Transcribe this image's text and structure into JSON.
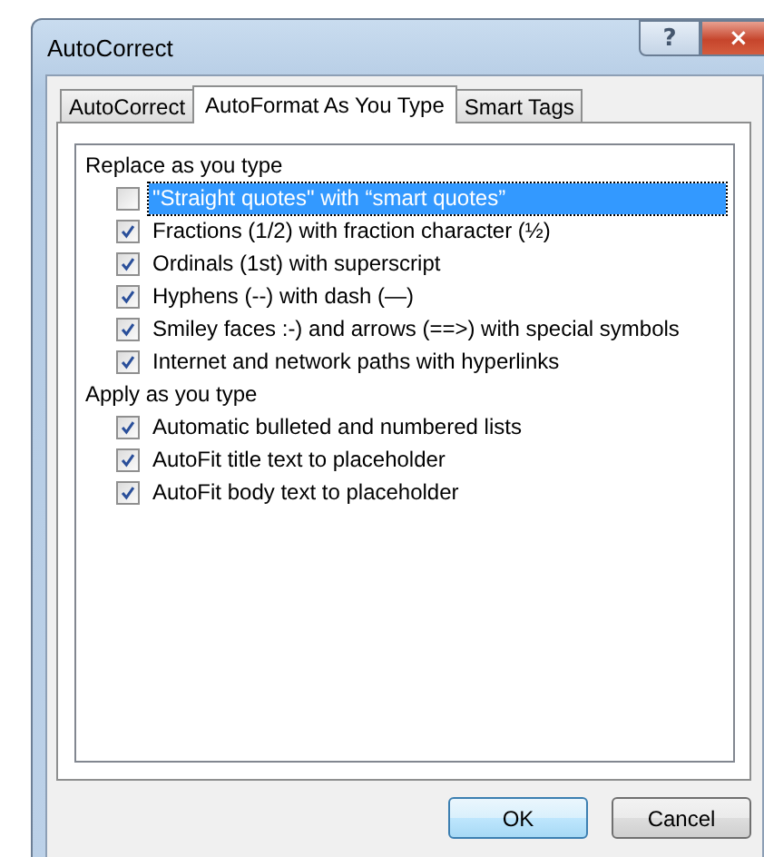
{
  "window": {
    "title": "AutoCorrect",
    "help_button": "?",
    "close_button": "×"
  },
  "tabs": [
    {
      "label": "AutoCorrect",
      "selected": false
    },
    {
      "label": "AutoFormat As You Type",
      "selected": true
    },
    {
      "label": "Smart Tags",
      "selected": false
    }
  ],
  "sections": [
    {
      "heading": "Replace as you type",
      "items": [
        {
          "label": "\"Straight quotes\" with “smart quotes”",
          "checked": false,
          "selected": true
        },
        {
          "label": "Fractions (1/2) with fraction character (½)",
          "checked": true,
          "selected": false
        },
        {
          "label": "Ordinals (1st) with superscript",
          "checked": true,
          "selected": false
        },
        {
          "label": "Hyphens (--) with dash (—)",
          "checked": true,
          "selected": false
        },
        {
          "label": "Smiley faces :-) and arrows (==>) with special symbols",
          "checked": true,
          "selected": false
        },
        {
          "label": "Internet and network paths with hyperlinks",
          "checked": true,
          "selected": false
        }
      ]
    },
    {
      "heading": "Apply as you type",
      "items": [
        {
          "label": "Automatic bulleted and numbered lists",
          "checked": true,
          "selected": false
        },
        {
          "label": "AutoFit title text to placeholder",
          "checked": true,
          "selected": false
        },
        {
          "label": "AutoFit body text to placeholder",
          "checked": true,
          "selected": false
        }
      ]
    }
  ],
  "buttons": [
    {
      "label": "OK",
      "kind": "default"
    },
    {
      "label": "Cancel",
      "kind": "normal"
    }
  ]
}
